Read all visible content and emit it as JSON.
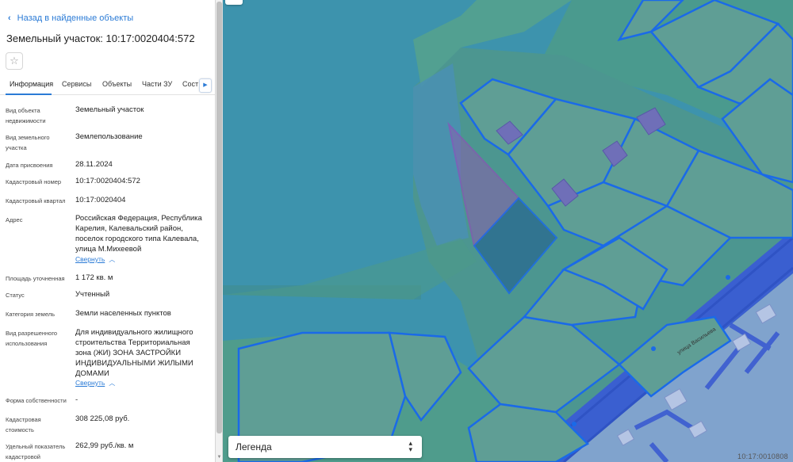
{
  "sidebar": {
    "back_label": "Назад в найденные объекты",
    "title": "Земельный участок: 10:17:0020404:572",
    "favorite_icon": "star-icon",
    "tabs": [
      "Информация",
      "Сервисы",
      "Объекты",
      "Части ЗУ",
      "Сост"
    ],
    "active_tab": "Информация",
    "rows": [
      {
        "label": "Вид объекта недвижимости",
        "value": "Земельный участок"
      },
      {
        "label": "Вид земельного участка",
        "value": "Землепользование"
      },
      {
        "label": "Дата присвоения",
        "value": "28.11.2024"
      },
      {
        "label": "Кадастровый номер",
        "value": "10:17:0020404:572"
      },
      {
        "label": "Кадастровый квартал",
        "value": "10:17:0020404"
      },
      {
        "label": "Адрес",
        "value": "Российская Федерация, Республика Карелия, Калевальский район, поселок городского типа Калевала, улица М.Михеевой"
      },
      {
        "label": "Площадь уточненная",
        "value": "1 172 кв. м"
      },
      {
        "label": "Статус",
        "value": "Учтенный"
      },
      {
        "label": "Категория земель",
        "value": "Земли населенных пунктов"
      },
      {
        "label": "Вид разрешенного использования",
        "value": "Для индивидуального жилищного строительства Территориальная зона (ЖИ) ЗОНА ЗАСТРОЙКИ ИНДИВИДУАЛЬНЫМИ ЖИЛЫМИ ДОМАМИ"
      },
      {
        "label": "Форма собственности",
        "value": "-"
      },
      {
        "label": "Кадастровая стоимость",
        "value": "308 225,08 руб."
      },
      {
        "label": "Удельный показатель кадастровой",
        "value": "262,99 руб./кв. м"
      }
    ],
    "collapse_label": "Свернуть"
  },
  "map": {
    "legend_label": "Легенда",
    "street_label": "улица Васильева",
    "code_label": "10:17:0010808",
    "colors": {
      "water": "#3d93ad",
      "parcel_fill": "#5a9a9a",
      "parcel_stroke": "#1565e0",
      "selected_stroke": "#9b3fb0",
      "road": "#3a5fd0",
      "buildings": "#6f6fb8"
    }
  }
}
